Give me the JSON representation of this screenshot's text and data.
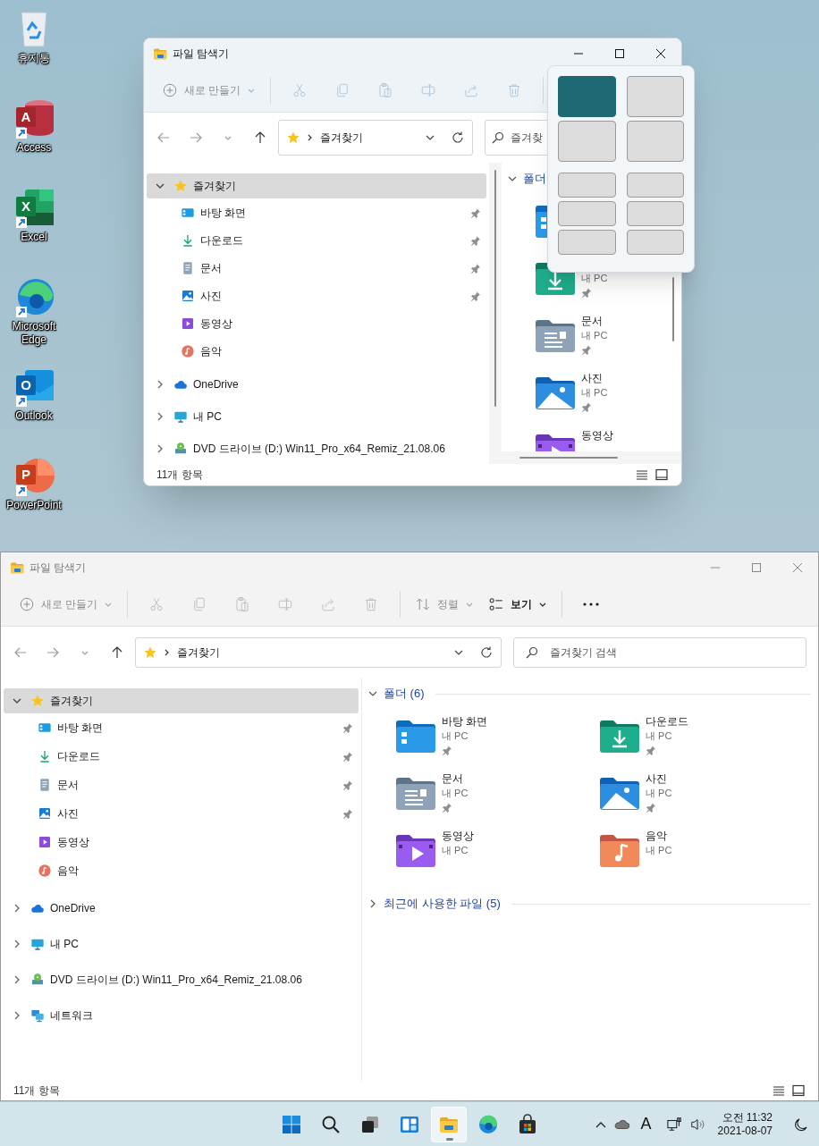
{
  "desktop_icons": [
    {
      "kind": "recycle-bin",
      "label": "휴지통"
    },
    {
      "kind": "access",
      "label": "Access",
      "glyph": "A"
    },
    {
      "kind": "excel",
      "label": "Excel",
      "glyph": "X"
    },
    {
      "kind": "edge",
      "label": "Microsoft Edge"
    },
    {
      "kind": "outlook",
      "label": "Outlook",
      "glyph": "O"
    },
    {
      "kind": "powerpoint",
      "label": "PowerPoint",
      "glyph": "P"
    }
  ],
  "top_window": {
    "title": "파일 탐색기",
    "active": true,
    "toolbar": [
      {
        "kind": "new",
        "label": "새로 만들기",
        "disabled": true
      },
      {
        "kind": "cut",
        "disabled": true
      },
      {
        "kind": "copy",
        "disabled": true
      },
      {
        "kind": "paste",
        "disabled": true
      },
      {
        "kind": "rename",
        "disabled": true
      },
      {
        "kind": "share",
        "disabled": true
      },
      {
        "kind": "delete",
        "disabled": true
      }
    ],
    "address": {
      "path": "즐겨찾기"
    },
    "search": {
      "placeholder": "즐겨찾"
    },
    "nav": [
      {
        "kind": "favorites",
        "label": "즐겨찾기",
        "expanded": true,
        "selected": true,
        "children": [
          {
            "kind": "desktop",
            "label": "바탕 화면",
            "pinned": true,
            "selected": false
          },
          {
            "kind": "download",
            "label": "다운로드",
            "pinned": true,
            "selected": false
          },
          {
            "kind": "documents",
            "label": "문서",
            "pinned": true,
            "selected": false
          },
          {
            "kind": "pictures",
            "label": "사진",
            "pinned": true,
            "selected": false
          },
          {
            "kind": "videos",
            "label": "동영상",
            "pinned": false,
            "selected": false
          },
          {
            "kind": "music",
            "label": "음악",
            "pinned": false,
            "selected": false
          }
        ]
      },
      {
        "kind": "onedrive",
        "label": "OneDrive",
        "expanded": false,
        "selected": false
      },
      {
        "kind": "pc",
        "label": "내 PC",
        "expanded": false,
        "selected": false
      },
      {
        "kind": "dvd",
        "label": "DVD 드라이브 (D:) Win11_Pro_x64_Remiz_21.08.06",
        "expanded": false,
        "selected": false
      }
    ],
    "sections": [
      {
        "title": "폴더",
        "expanded": true,
        "items": [
          {
            "kind": "desktop"
          },
          {
            "kind": "download",
            "location": "내 PC",
            "pinned": true
          },
          {
            "kind": "documents",
            "name": "문서",
            "location": "내 PC",
            "pinned": true
          },
          {
            "kind": "pictures",
            "name": "사진",
            "location": "내 PC",
            "pinned": true
          },
          {
            "kind": "videos",
            "name": "동영상",
            "pinned": false
          }
        ]
      }
    ],
    "status": "11개 항목"
  },
  "snap_layouts": [
    {
      "kind": "quad",
      "zones": [
        {
          "selected": true
        },
        {
          "selected": false
        },
        {
          "selected": false
        },
        {
          "selected": false
        }
      ]
    },
    {
      "kind": "six",
      "zones": [
        {
          "selected": false
        },
        {
          "selected": false
        },
        {
          "selected": false
        },
        {
          "selected": false
        },
        {
          "selected": false
        },
        {
          "selected": false
        }
      ]
    }
  ],
  "bottom_window": {
    "title": "파일 탐색기",
    "active": false,
    "toolbar": [
      {
        "kind": "new",
        "label": "새로 만들기",
        "disabled": true
      },
      {
        "kind": "cut",
        "disabled": true
      },
      {
        "kind": "copy",
        "disabled": true
      },
      {
        "kind": "paste",
        "disabled": true
      },
      {
        "kind": "rename",
        "disabled": true
      },
      {
        "kind": "share",
        "disabled": true
      },
      {
        "kind": "delete",
        "disabled": true
      },
      {
        "kind": "sort",
        "label": "정렬",
        "disabled": true
      },
      {
        "kind": "view",
        "label": "보기",
        "disabled": false
      },
      {
        "kind": "more",
        "disabled": false
      }
    ],
    "address": {
      "path": "즐겨찾기"
    },
    "search": {
      "placeholder": "즐겨찾기 검색"
    },
    "nav": [
      {
        "kind": "favorites",
        "label": "즐겨찾기",
        "expanded": true,
        "selected": true,
        "children": [
          {
            "kind": "desktop",
            "label": "바탕 화면",
            "pinned": true,
            "selected": false
          },
          {
            "kind": "download",
            "label": "다운로드",
            "pinned": true,
            "selected": false
          },
          {
            "kind": "documents",
            "label": "문서",
            "pinned": true,
            "selected": false
          },
          {
            "kind": "pictures",
            "label": "사진",
            "pinned": true,
            "selected": false
          },
          {
            "kind": "videos",
            "label": "동영상",
            "pinned": false,
            "selected": false
          },
          {
            "kind": "music",
            "label": "음악",
            "pinned": false,
            "selected": false
          }
        ]
      },
      {
        "kind": "onedrive",
        "label": "OneDrive",
        "expanded": false,
        "selected": false
      },
      {
        "kind": "pc",
        "label": "내 PC",
        "expanded": false,
        "selected": false
      },
      {
        "kind": "dvd",
        "label": "DVD 드라이브 (D:) Win11_Pro_x64_Remiz_21.08.06",
        "expanded": false,
        "selected": false
      },
      {
        "kind": "network",
        "label": "네트워크",
        "expanded": false,
        "selected": false
      }
    ],
    "sections": [
      {
        "title": "폴더 (6)",
        "expanded": true,
        "items": [
          {
            "kind": "desktop",
            "name": "바탕 화면",
            "location": "내 PC",
            "pinned": true
          },
          {
            "kind": "download",
            "name": "다운로드",
            "location": "내 PC",
            "pinned": true
          },
          {
            "kind": "documents",
            "name": "문서",
            "location": "내 PC",
            "pinned": true
          },
          {
            "kind": "pictures",
            "name": "사진",
            "location": "내 PC",
            "pinned": true
          },
          {
            "kind": "videos",
            "name": "동영상",
            "location": "내 PC",
            "pinned": false
          },
          {
            "kind": "music",
            "name": "음악",
            "location": "내 PC",
            "pinned": false
          }
        ]
      },
      {
        "title": "최근에 사용한 파일 (5)",
        "expanded": false
      }
    ],
    "status": "11개 항목"
  },
  "taskbar": {
    "apps": [
      {
        "kind": "start",
        "active": false
      },
      {
        "kind": "search",
        "active": false
      },
      {
        "kind": "taskview",
        "active": false
      },
      {
        "kind": "widgets",
        "active": false
      },
      {
        "kind": "explorer",
        "active": true
      },
      {
        "kind": "edge",
        "active": false
      },
      {
        "kind": "store",
        "active": false
      }
    ],
    "input_indicator": "A",
    "time": "오전 11:32",
    "date": "2021-08-07"
  }
}
